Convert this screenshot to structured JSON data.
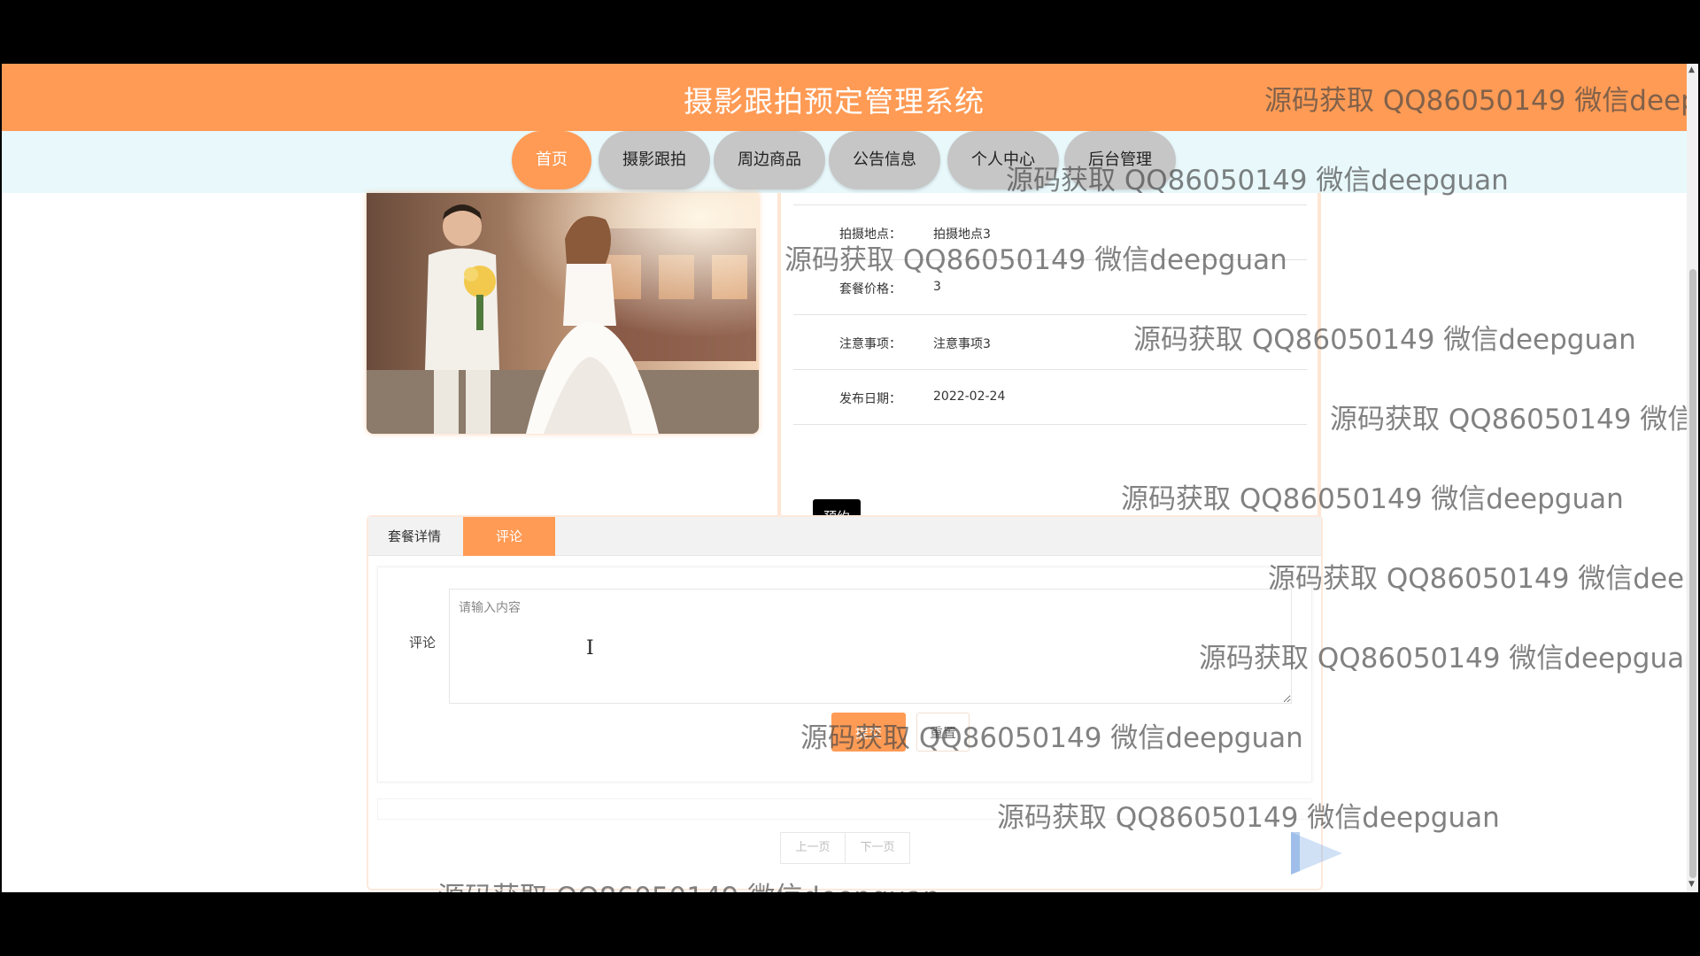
{
  "header": {
    "title": "摄影跟拍预定管理系统"
  },
  "nav": {
    "items": [
      {
        "label": "首页",
        "active": true
      },
      {
        "label": "摄影跟拍",
        "active": false
      },
      {
        "label": "周边商品",
        "active": false
      },
      {
        "label": "公告信息",
        "active": false
      },
      {
        "label": "个人中心",
        "active": false
      },
      {
        "label": "后台管理",
        "active": false
      }
    ]
  },
  "product": {
    "fields": [
      {
        "label": "拍摄地点：",
        "value": "拍摄地点3"
      },
      {
        "label": "套餐价格：",
        "value": "3"
      },
      {
        "label": "注意事项：",
        "value": "注意事项3"
      },
      {
        "label": "发布日期：",
        "value": "2022-02-24"
      }
    ],
    "book_label": "预约"
  },
  "tabs": {
    "items": [
      {
        "label": "套餐详情",
        "active": false
      },
      {
        "label": "评论",
        "active": true
      }
    ]
  },
  "comment": {
    "label": "评论",
    "placeholder": "请输入内容",
    "submit_label": "提交",
    "reset_label": "重置"
  },
  "pagination": {
    "prev_label": "上一页",
    "next_label": "下一页"
  },
  "watermark": {
    "text": "源码获取 QQ86050149 微信deepguan"
  },
  "colors": {
    "accent": "#ff9b55",
    "nav_bg": "#e8f8fb",
    "book_button": "#000000"
  }
}
